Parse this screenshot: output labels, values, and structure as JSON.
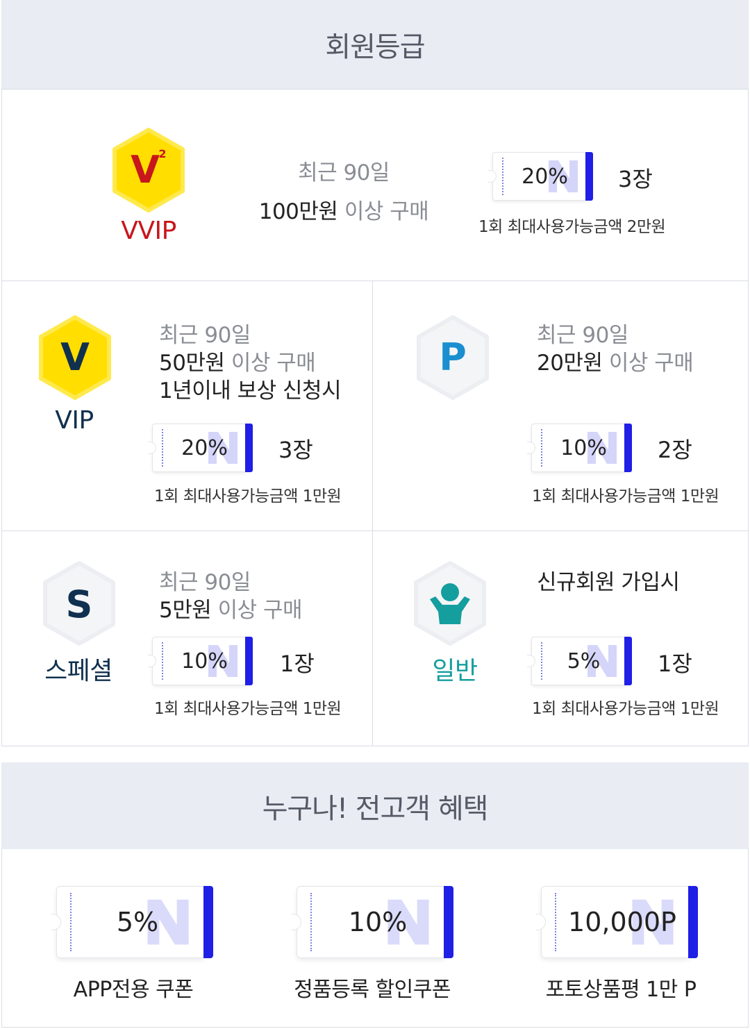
{
  "membership": {
    "title": "회원등급",
    "grades": {
      "vvip": {
        "name": "VVIP",
        "badge_letter": "V",
        "badge_superscript": "2",
        "condition_line1": "최근 90일",
        "condition_amount": "100만원",
        "condition_suffix": "이상 구매",
        "coupon_value": "20%",
        "coupon_qty": "3장",
        "limit": "1회 최대사용가능금액 2만원"
      },
      "vip": {
        "name": "VIP",
        "badge_letter": "V",
        "condition_line1": "최근 90일",
        "condition_amount": "50만원",
        "condition_suffix": "이상 구매",
        "condition_line3": "1년이내 보상 신청시",
        "coupon_value": "20%",
        "coupon_qty": "3장",
        "limit": "1회 최대사용가능금액 1만원"
      },
      "prime": {
        "badge_letter": "P",
        "condition_line1": "최근 90일",
        "condition_amount": "20만원",
        "condition_suffix": "이상 구매",
        "coupon_value": "10%",
        "coupon_qty": "2장",
        "limit": "1회 최대사용가능금액 1만원"
      },
      "special": {
        "name": "스페셜",
        "badge_letter": "S",
        "condition_line1": "최근 90일",
        "condition_amount": "5만원",
        "condition_suffix": "이상 구매",
        "coupon_value": "10%",
        "coupon_qty": "1장",
        "limit": "1회 최대사용가능금액 1만원"
      },
      "normal": {
        "name": "일반",
        "condition_line1": "신규회원 가입시",
        "coupon_value": "5%",
        "coupon_qty": "1장",
        "limit": "1회 최대사용가능금액 1만원"
      }
    }
  },
  "benefits": {
    "title": "누구나! 전고객 혜택",
    "items": [
      {
        "value": "5%",
        "label": "APP전용 쿠폰"
      },
      {
        "value": "10%",
        "label": "정품등록 할인쿠폰"
      },
      {
        "value": "10,000P",
        "label": "포토상품평 1만 P"
      }
    ]
  },
  "colors": {
    "header_bg": "#e9ecf3",
    "accent_blue": "#1f1fe6",
    "vvip_red": "#c8161d",
    "badge_yellow": "#ffde00",
    "navy": "#10304f",
    "teal": "#159e9e"
  }
}
